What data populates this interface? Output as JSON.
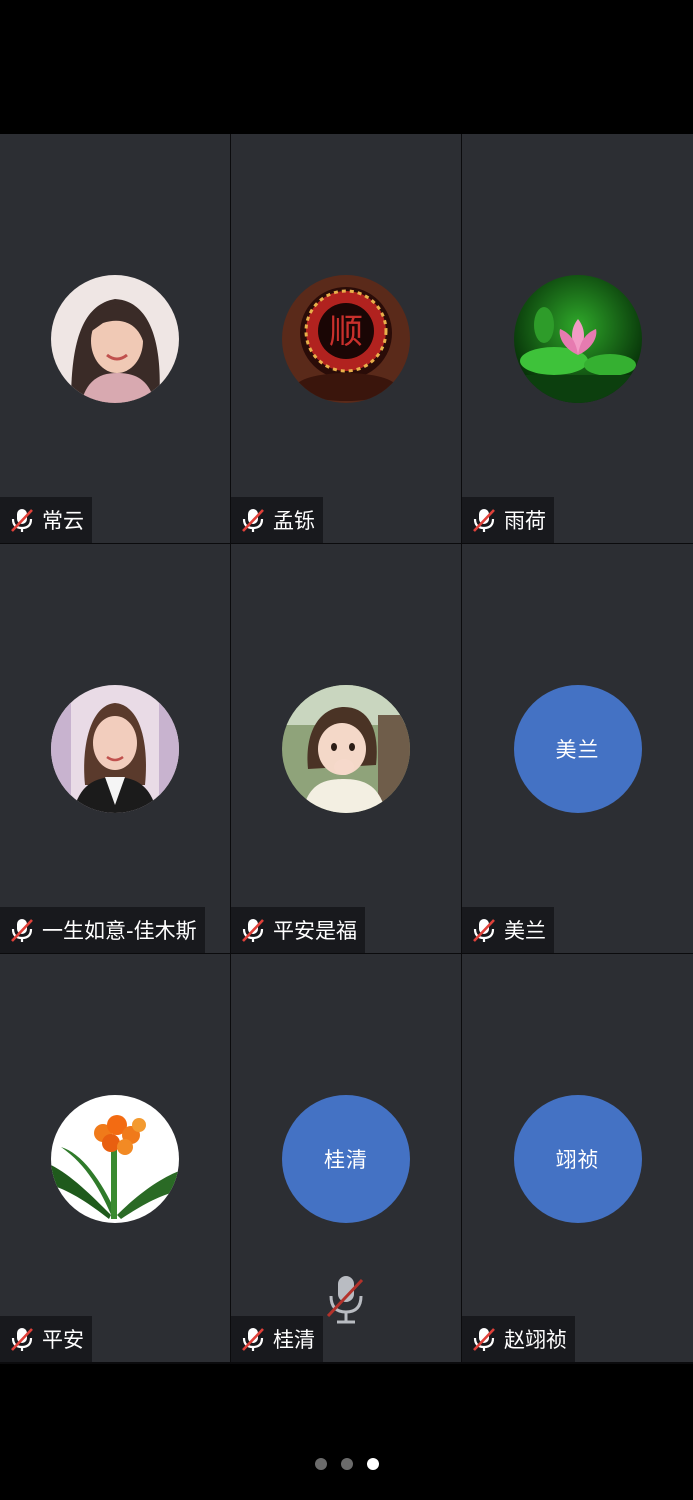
{
  "participants": [
    {
      "name": "常云",
      "avatar": "photo-woman-smiling",
      "mic": "muted"
    },
    {
      "name": "孟铄",
      "avatar": "red-character-emblem",
      "mic": "muted"
    },
    {
      "name": "雨荷",
      "avatar": "lotus-flower",
      "mic": "muted"
    },
    {
      "name": "一生如意-佳木斯",
      "avatar": "photo-woman",
      "mic": "muted"
    },
    {
      "name": "平安是福",
      "avatar": "photo-child",
      "mic": "muted"
    },
    {
      "name": "美兰",
      "avatar_text": "美兰",
      "mic": "muted"
    },
    {
      "name": "平安",
      "avatar": "orange-clivia-flower",
      "mic": "muted"
    },
    {
      "name": "桂清",
      "avatar_text": "桂清",
      "mic": "muted"
    },
    {
      "name": "赵翊祯",
      "avatar_text": "翊祯",
      "mic": "muted"
    }
  ],
  "pager": {
    "pages": 3,
    "active": 3
  },
  "colors": {
    "tile_bg": "#2c2e33",
    "initials_bg": "#4472c4",
    "mute_slash": "#e0413a",
    "background": "#000000"
  }
}
